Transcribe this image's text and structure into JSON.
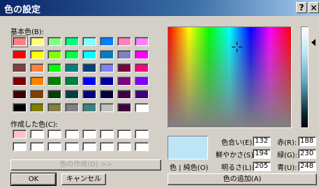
{
  "window": {
    "title": "色の設定",
    "help_label": "?",
    "close_label": "×"
  },
  "basic_colors": {
    "label": "基本色(B):",
    "rows": [
      [
        "#ff8080",
        "#ffff80",
        "#80ff80",
        "#00ff80",
        "#80ffff",
        "#0080ff",
        "#ff80c0",
        "#ff80ff"
      ],
      [
        "#ff0000",
        "#ffff00",
        "#80ff00",
        "#00ff40",
        "#00ffff",
        "#0080c0",
        "#8080c0",
        "#ff00ff"
      ],
      [
        "#804040",
        "#ff8040",
        "#00ff00",
        "#008080",
        "#004080",
        "#8080ff",
        "#800040",
        "#ff0080"
      ],
      [
        "#800000",
        "#ff8000",
        "#008000",
        "#008040",
        "#0000ff",
        "#0000a0",
        "#800080",
        "#8000ff"
      ],
      [
        "#400000",
        "#804000",
        "#004000",
        "#004040",
        "#000080",
        "#000040",
        "#400040",
        "#400080"
      ],
      [
        "#000000",
        "#808000",
        "#808040",
        "#808080",
        "#408080",
        "#c0c0c0",
        "#400040",
        "#ffffff"
      ]
    ]
  },
  "custom_colors": {
    "label": "作成した色(C):",
    "rows": [
      [
        "#ffc0cb",
        "#ffffff",
        "#ffffff",
        "#ffffff",
        "#ffffff",
        "#ffffff",
        "#ffffff",
        "#ffffff"
      ],
      [
        "#ffffff",
        "#ffffff",
        "#ffffff",
        "#ffffff",
        "#ffffff",
        "#ffffff",
        "#ffffff",
        "#ffffff"
      ]
    ]
  },
  "buttons": {
    "define_custom": "色の作成(D) >>",
    "ok": "OK",
    "cancel": "キャンセル",
    "add_custom": "色の追加(A)"
  },
  "preview": {
    "label": "色 | 純色(O)",
    "color": "#bce6f8"
  },
  "fields": {
    "hue": {
      "label": "色合い(E):",
      "value": "132"
    },
    "sat": {
      "label": "鮮やかさ(S):",
      "value": "194"
    },
    "lum": {
      "label": "明るさ(L):",
      "value": "205"
    },
    "red": {
      "label": "赤(R):",
      "value": "188"
    },
    "green": {
      "label": "緑(G):",
      "value": "230"
    },
    "blue": {
      "label": "青(U):",
      "value": "248"
    }
  }
}
